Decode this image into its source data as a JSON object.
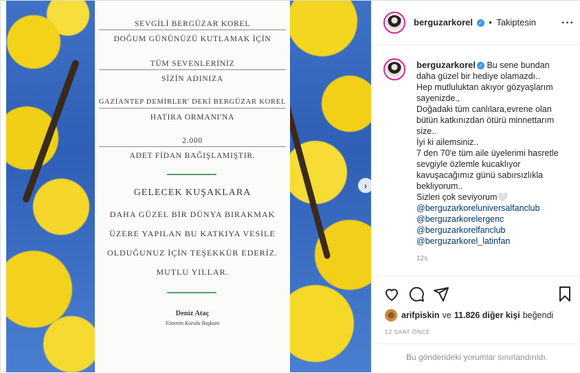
{
  "media": {
    "lines": [
      "SEVGİLİ BERGÜZAR KOREL",
      "DOĞUM GÜNÜNÜZÜ KUTLAMAK İÇİN",
      "TÜM SEVENLERİNİZ",
      "SİZİN ADINIZA",
      "GAZİANTEP DEMİRLER' DEKİ BERGÜZAR KOREL",
      "HATIRA ORMANI'NA",
      "2.000",
      "ADET FİDAN BAĞIŞLAMIŞTIR.",
      "GELECEK KUŞAKLARA",
      "DAHA GÜZEL BİR DÜNYA BIRAKMAK",
      "ÜZERE YAPILAN BU KATKIYA VESİLE",
      "OLDUĞUNUZ İÇİN TEŞEKKÜR EDERİZ.",
      "MUTLU YILLAR."
    ],
    "signer_name": "Deniz Ataç",
    "signer_title": "Yönetim Kurulu Başkanı",
    "next_icon": "chevron-right-icon"
  },
  "header": {
    "username": "berguzarkorel",
    "separator": "•",
    "follow_status": "Takiptesin",
    "more_icon": "more-dots-icon"
  },
  "caption": {
    "username": "berguzarkorel",
    "lines": [
      "Bu sene bundan",
      "daha güzel bir hediye olamazdı..",
      "Hep mutluluktan akıyor gözyaşlarım",
      "sayenizde.,",
      "Doğadaki tüm canlılara,evrene olan",
      "bütün katkınızdan ötürü minnettarım",
      "size..",
      "İyi ki ailemsiniz..",
      "7 den 70'e tüm aile üyelerimi hasretle",
      "sevgiyle özlemle kucaklıyor",
      "kavuşacağımız günü sabırsızlıkla",
      "bekliyorum..",
      "Sizleri çok seviyorum🤍"
    ],
    "mentions": [
      "@berguzarkoreluniversalfanclub",
      "@berguzarkorelergenc",
      "@berguzarkorelfanclub",
      "@berguzarkorel_latinfan"
    ],
    "time": "12s"
  },
  "actions": {
    "like_icon": "heart-icon",
    "comment_icon": "comment-icon",
    "share_icon": "share-icon",
    "save_icon": "bookmark-icon"
  },
  "likes": {
    "user": "arifpiskin",
    "connector": "ve",
    "count_text": "11.826 diğer kişi",
    "suffix": "beğendi"
  },
  "posted_ago": "12 SAAT ÖNCE",
  "comments_restricted": "Bu gönderideki yorumlar sınırlandırıldı.",
  "colors": {
    "verified": "#3897f0",
    "mention": "#00376b",
    "avatar_ring": "#d6249f"
  }
}
